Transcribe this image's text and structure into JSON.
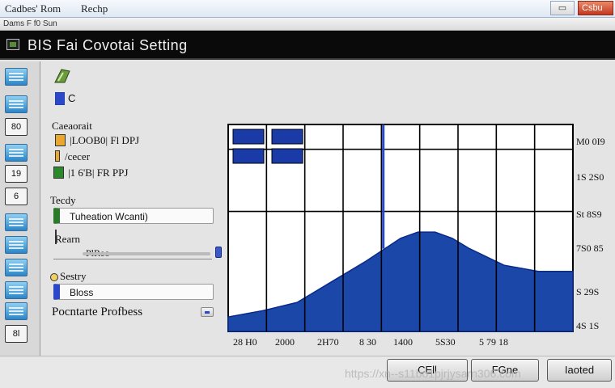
{
  "outer_window": {
    "title_left": "Cadbes' Rom",
    "title_right": "Rechp",
    "close_label": "Csbu",
    "strip_text": "Dams F f0 Sun"
  },
  "window": {
    "title": "BIS Fai Covotai Setting"
  },
  "sidebar": {
    "items": [
      {
        "icon": "monitor-icon"
      },
      {
        "icon": "monitor-icon"
      },
      {
        "icon": "text-icon",
        "label": "80"
      },
      {
        "icon": "monitor-icon"
      },
      {
        "icon": "text-icon",
        "label": "19"
      },
      {
        "icon": "text-icon",
        "label": "6"
      },
      {
        "icon": "monitor-icon"
      },
      {
        "icon": "monitor-icon"
      },
      {
        "icon": "monitor-icon"
      },
      {
        "icon": "monitor-icon"
      },
      {
        "icon": "monitor-icon"
      },
      {
        "icon": "text-icon",
        "label": "8l"
      }
    ]
  },
  "panel": {
    "pc_label": "C",
    "section1_label": "Caeaorait",
    "row1_value": "|LOOB0| Fl DPJ",
    "row2_label": "/cecer",
    "row2_value": "|1 6'B| FR PPJ",
    "section2_label": "Tecdy",
    "field1_value": "Tuheation Wcanti)",
    "section3_label": "Rearn",
    "slider_label": "PlReo",
    "section4_label": "Sestry",
    "field2_value": "Bloss",
    "bottom_text": "Pocntarte Profbess"
  },
  "chart_data": {
    "type": "area",
    "x_tick_labels": [
      "28 H0",
      "2000",
      "2H70",
      "8 30",
      "1400",
      "5S30",
      "5 79 18"
    ],
    "y_tick_labels": [
      "M0 0I9",
      "1S 2S0",
      "St 8S9",
      "7S0 85",
      "S 29S",
      "4S 1S"
    ],
    "x": [
      0,
      10,
      20,
      30,
      40,
      50,
      55,
      60,
      65,
      70,
      80,
      90,
      100
    ],
    "values": [
      7,
      10,
      14,
      24,
      34,
      45,
      48,
      48,
      45,
      40,
      32,
      29,
      29
    ],
    "ylim": [
      0,
      100
    ],
    "legend_blocks": 4,
    "grid": true,
    "colors": {
      "fill": "#1a47a8",
      "grid": "#000000"
    }
  },
  "buttons": {
    "left_label": "CEll",
    "mid_label": "FGne",
    "right_label": "Iaoted"
  },
  "watermark": "https://xn--s11bo1pjrjysarn306.com"
}
